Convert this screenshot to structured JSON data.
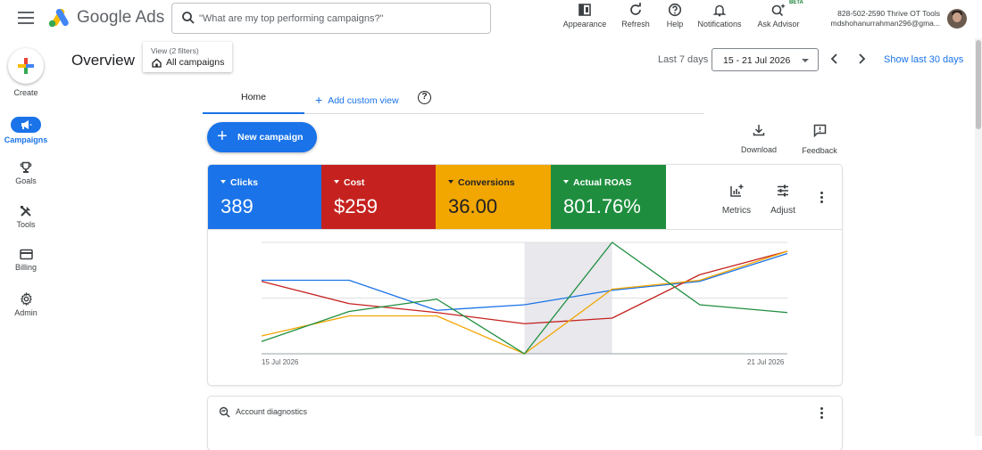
{
  "app": {
    "brand": "Google Ads",
    "search_placeholder": "\"What are my top performing campaigns?\""
  },
  "toolbar": {
    "appearance": "Appearance",
    "refresh": "Refresh",
    "help": "Help",
    "notifications": "Notifications",
    "ask_advisor": "Ask Advisor",
    "beta": "BETA"
  },
  "account": {
    "line1": "828-502-2590 Thrive OT Tools",
    "line2": "mdshohanurrahman296@gma..."
  },
  "sidebar": {
    "create": "Create",
    "items": [
      {
        "label": "Campaigns",
        "icon": "megaphone-icon",
        "active": true
      },
      {
        "label": "Goals",
        "icon": "trophy-icon"
      },
      {
        "label": "Tools",
        "icon": "tools-icon"
      },
      {
        "label": "Billing",
        "icon": "credit-card-icon"
      },
      {
        "label": "Admin",
        "icon": "gear-icon"
      }
    ]
  },
  "header": {
    "title": "Overview",
    "view_filters": "View (2 filters)",
    "view_name": "All campaigns",
    "date_label": "Last 7 days",
    "date_range": "15 - 21 Jul 2026",
    "show_last": "Show last 30 days"
  },
  "tabs": {
    "home": "Home",
    "add_view": "Add custom view",
    "help": "?"
  },
  "actions": {
    "new_campaign": "New campaign",
    "download": "Download",
    "feedback": "Feedback"
  },
  "metrics": [
    {
      "name": "Clicks",
      "value": "389",
      "color": "#1a73e8"
    },
    {
      "name": "Cost",
      "value": "$259",
      "color": "#c5221f"
    },
    {
      "name": "Conversions",
      "value": "36.00",
      "color": "#f2a600"
    },
    {
      "name": "Actual ROAS",
      "value": "801.76%",
      "color": "#1e8e3e"
    }
  ],
  "card_tools": {
    "metrics": "Metrics",
    "adjust": "Adjust"
  },
  "chart_data": {
    "type": "line",
    "x": [
      "15 Jul 2026",
      "16 Jul 2026",
      "17 Jul 2026",
      "18 Jul 2026",
      "19 Jul 2026",
      "20 Jul 2026",
      "21 Jul 2026"
    ],
    "x_tick_labels": [
      "15 Jul 2026",
      "21 Jul 2026"
    ],
    "highlight_index": 3,
    "ylim": [
      0,
      1
    ],
    "grid": true,
    "series": [
      {
        "name": "Clicks",
        "color": "#1a73e8",
        "values": [
          0.66,
          0.66,
          0.39,
          0.44,
          0.57,
          0.65,
          0.9
        ]
      },
      {
        "name": "Cost",
        "color": "#c5221f",
        "values": [
          0.65,
          0.45,
          0.37,
          0.27,
          0.32,
          0.71,
          0.92
        ]
      },
      {
        "name": "Conversions",
        "color": "#f2a600",
        "values": [
          0.16,
          0.34,
          0.34,
          0.0,
          0.58,
          0.66,
          0.92
        ]
      },
      {
        "name": "Actual ROAS",
        "color": "#1e8e3e",
        "values": [
          0.11,
          0.38,
          0.49,
          0.0,
          1.0,
          0.44,
          0.37
        ]
      }
    ]
  },
  "diagnostics": {
    "title": "Account diagnostics"
  }
}
